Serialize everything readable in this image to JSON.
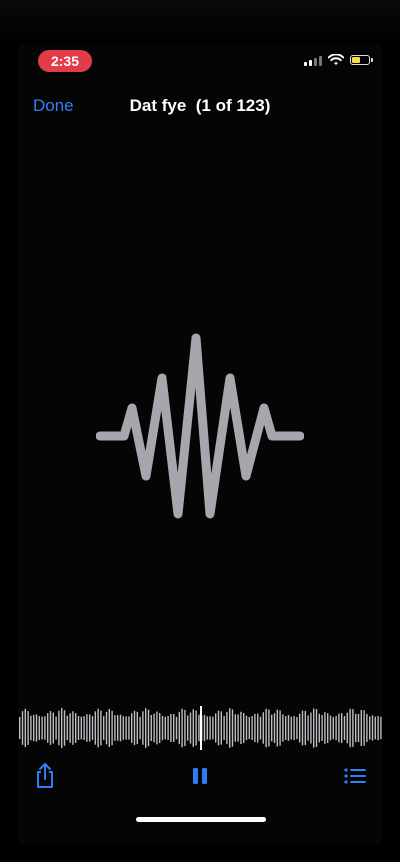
{
  "status_bar": {
    "time": "2:35",
    "time_pill_color": "#e23b4a",
    "battery_color": "#f5e142",
    "icons": [
      "cellular-signal-icon",
      "wifi-icon",
      "battery-icon"
    ]
  },
  "nav": {
    "done_label": "Done",
    "title": "Dat fye  (1 of 123)",
    "accent_color": "#2f7df6"
  },
  "media": {
    "placeholder_icon": "audio-waveform-icon",
    "scrubber_playhead_fraction": 0.5
  },
  "toolbar": {
    "share_icon": "share-icon",
    "pause_icon": "pause-icon",
    "list_icon": "list-icon"
  }
}
